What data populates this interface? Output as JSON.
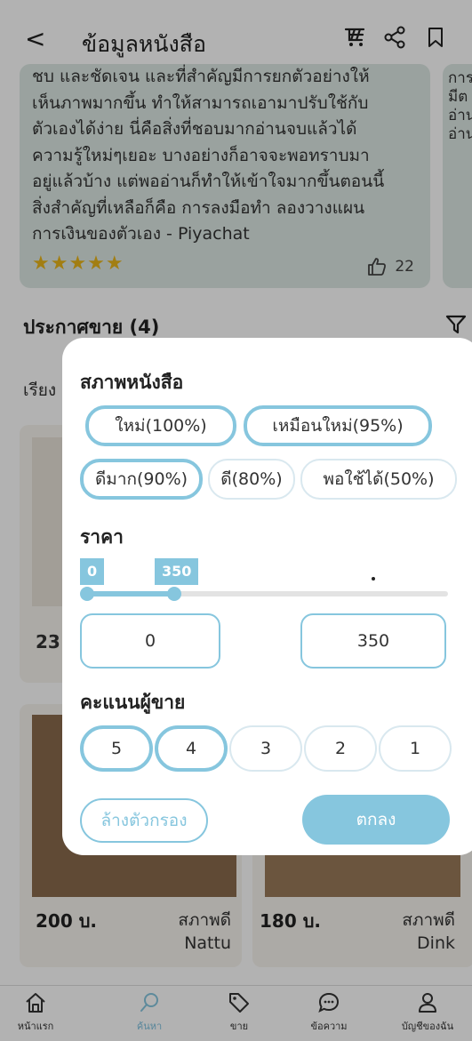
{
  "header": {
    "back_glyph": "<",
    "title": "ข้อมูลหนังสือ",
    "icons": [
      "cart-icon",
      "share-icon",
      "bookmark-icon"
    ]
  },
  "review": {
    "text_lines": [
      "ชบ และชัดเจน และที่สำคัญมีการยกตัวอย่างให้",
      "เห็นภาพมากขึ้น ทำให้สามารถเอามาปรับใช้กับ",
      "ตัวเองได้ง่าย นี่คือสิ่งที่ชอบมากอ่านจบแล้วได้",
      "ความรู้ใหม่ๆเยอะ บางอย่างก็อาจจะพอทราบมา",
      "อยู่แล้วบ้าง แต่พออ่านก็ทำให้เข้าใจมากขึ้นตอนนี้",
      "สิ่งสำคัญที่เหลือก็คือ การลงมือทำ ลองวางแผน",
      "การเงินของตัวเอง - Piyachat"
    ],
    "stars": "★★★★★",
    "like_count": "22",
    "next_fragment": [
      "การ",
      "มีต",
      "อ่าน",
      "อ่าน"
    ]
  },
  "listings": {
    "section_title": "ประกาศขาย (4)",
    "sort_label": "เรียง",
    "partial_price": "23",
    "cards": [
      {
        "price": "200 บ.",
        "condition": "สภาพดี",
        "seller": "Nattu"
      },
      {
        "price": "180 บ.",
        "condition": "สภาพดี",
        "seller": "Dink"
      }
    ]
  },
  "filter": {
    "condition_label": "สภาพหนังสือ",
    "conditions": [
      {
        "label": "ใหม่(100%)",
        "selected": true
      },
      {
        "label": "เหมือนใหม่(95%)",
        "selected": true
      },
      {
        "label": "ดีมาก(90%)",
        "selected": true
      },
      {
        "label": "ดี(80%)",
        "selected": false
      },
      {
        "label": "พอใช้ได้(50%)",
        "selected": false
      }
    ],
    "price_label": "ราคา",
    "price_min": "0",
    "price_max": "350",
    "price_min_input": "0",
    "price_max_input": "350",
    "rating_label": "คะแนนผู้ขาย",
    "ratings": [
      {
        "label": "5",
        "selected": true
      },
      {
        "label": "4",
        "selected": true
      },
      {
        "label": "3",
        "selected": false
      },
      {
        "label": "2",
        "selected": false
      },
      {
        "label": "1",
        "selected": false
      }
    ],
    "clear_label": "ล้างตัวกรอง",
    "ok_label": "ตกลง"
  },
  "nav": {
    "items": [
      {
        "label": "หน้าแรก",
        "icon": "home-icon",
        "active": false
      },
      {
        "label": "ค้นหา",
        "icon": "search-icon",
        "active": true
      },
      {
        "label": "ขาย",
        "icon": "tag-icon",
        "active": false
      },
      {
        "label": "ข้อความ",
        "icon": "chat-icon",
        "active": false
      },
      {
        "label": "บัญชีของฉัน",
        "icon": "user-icon",
        "active": false
      }
    ]
  },
  "colors": {
    "accent": "#86c6de",
    "card_bg": "#dde9e4",
    "star": "#e9b51a"
  }
}
